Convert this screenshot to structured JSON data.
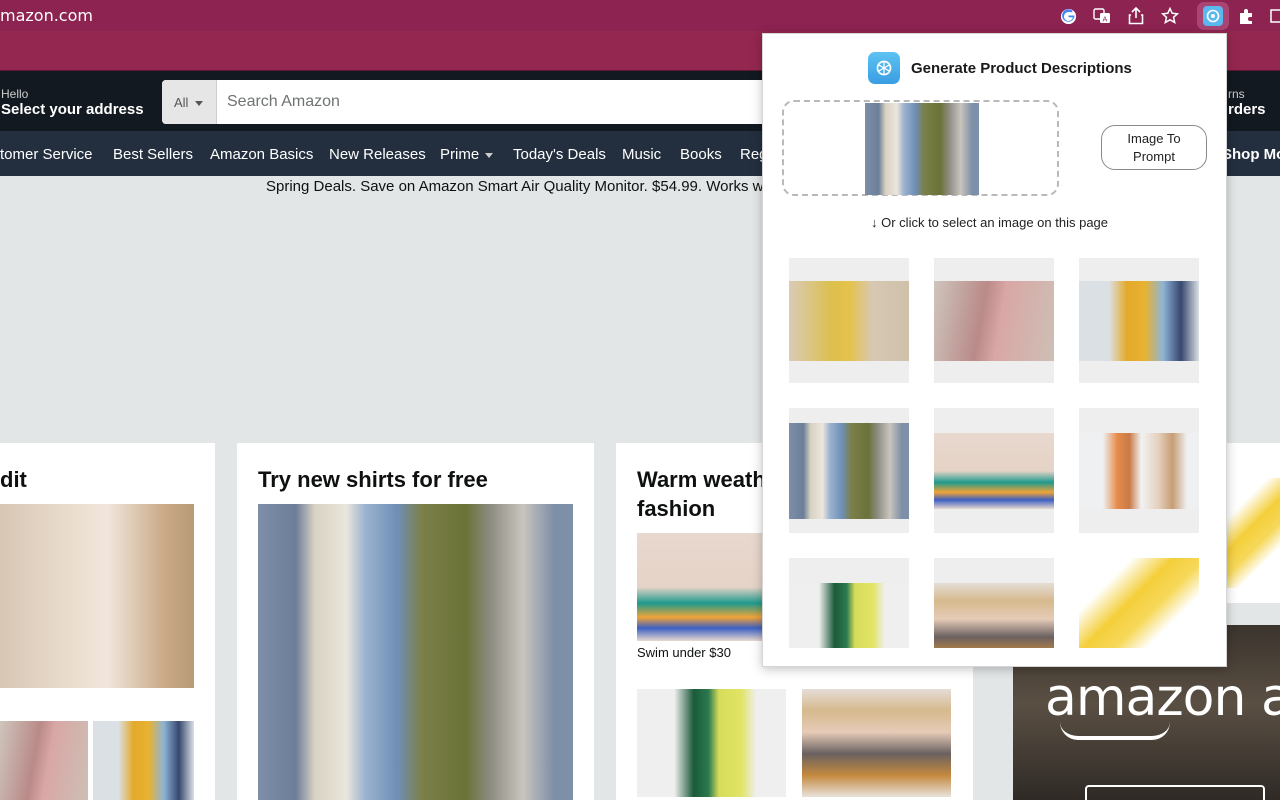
{
  "browser": {
    "url": "mazon.com",
    "icons": [
      "google-icon",
      "translate-icon",
      "share-icon",
      "star-icon",
      "chatgpt-extension-icon",
      "puzzle-icon"
    ]
  },
  "header": {
    "address_hello": "Hello",
    "address_main": "Select your address",
    "search_category": "All",
    "search_placeholder": "Search Amazon",
    "returns_top": "rns",
    "returns_bottom": "rders"
  },
  "nav": {
    "items": [
      "tomer Service",
      "Best Sellers",
      "Amazon Basics",
      "New Releases",
      "Prime",
      "Today's Deals",
      "Music",
      "Books",
      "Reg"
    ],
    "right_item": "Shop Mo"
  },
  "promo": "Spring Deals. Save on Amazon Smart Air Quality Monitor. $54.99. Works w",
  "cards": {
    "edit_title": "dit",
    "shirts_title": "Try new shirts for free",
    "warm_title_line1": "Warm weath",
    "warm_title_line2": "fashion",
    "swim_label": "Swim under $30"
  },
  "ad": {
    "text": "amazon ad"
  },
  "popup": {
    "title": "Generate Product Descriptions",
    "button_label": "Image To Prompt",
    "hint_arrow": "↓",
    "hint": "Or click to select an image on this page",
    "grid_count": 9
  }
}
